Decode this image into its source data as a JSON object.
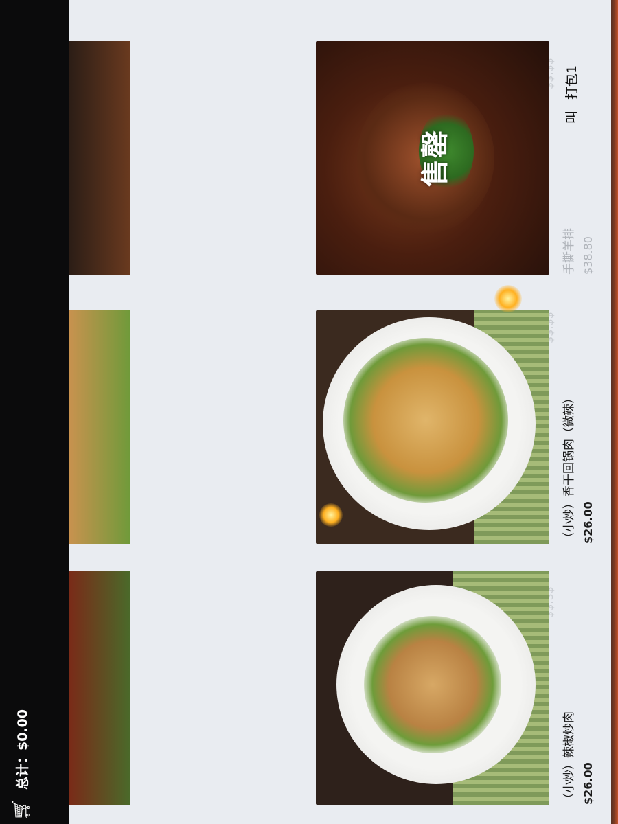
{
  "header": {
    "tabs": [
      {
        "label": "叫"
      },
      {
        "label": "打包1"
      }
    ]
  },
  "menu": {
    "items": [
      {
        "name": "手撕羊排",
        "price": "$38.80",
        "status": "售罄"
      },
      {
        "name": "（小炒）香干回锅肉（微辣）",
        "price": "$26.00",
        "status": ""
      },
      {
        "name": "（小炒）辣椒炒肉",
        "price": "$26.00",
        "status": ""
      }
    ]
  },
  "cart": {
    "total_label": "总计：$0.00",
    "icon": "shopping-cart-icon"
  },
  "colors": {
    "screen_bg": "#e9ecf1",
    "cart_bar": "#0b0b0c"
  }
}
